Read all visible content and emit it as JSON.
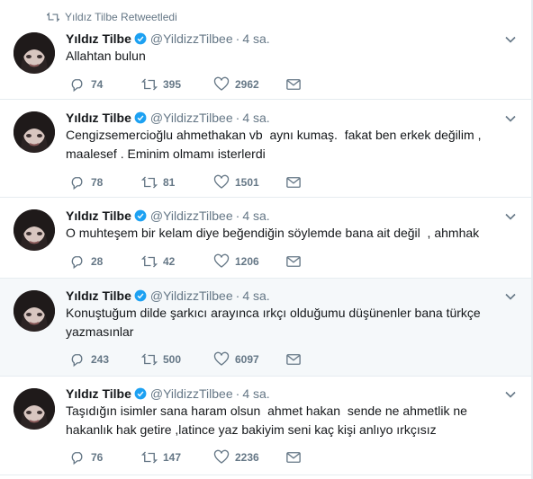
{
  "retweet_notice": "Yıldız Tilbe Retweetledi",
  "colors": {
    "verified": "#1da1f2",
    "muted": "#657786",
    "highlight_bg": "#f5f8fa"
  },
  "tweets": [
    {
      "name": "Yıldız Tilbe",
      "handle": "@YildizzTilbee",
      "time": "4 sa.",
      "text": "Allahtan bulun",
      "replies": "74",
      "retweets": "395",
      "likes": "2962"
    },
    {
      "name": "Yıldız Tilbe",
      "handle": "@YildizzTilbee",
      "time": "4 sa.",
      "text": "Cengizsemercioğlu ahmethakan vb  aynı kumaş.  fakat ben erkek değilim ,\nmaalesef . Eminim olmamı isterlerdi",
      "replies": "78",
      "retweets": "81",
      "likes": "1501"
    },
    {
      "name": "Yıldız Tilbe",
      "handle": "@YildizzTilbee",
      "time": "4 sa.",
      "text": "O muhteşem bir kelam diye beğendiğin söylemde bana ait değil  , ahmhak",
      "replies": "28",
      "retweets": "42",
      "likes": "1206"
    },
    {
      "name": "Yıldız Tilbe",
      "handle": "@YildizzTilbee",
      "time": "4 sa.",
      "text": "Konuştuğum dilde şarkıcı arayınca ırkçı olduğumu düşünenler bana türkçe\nyazmasınlar",
      "replies": "243",
      "retweets": "500",
      "likes": "6097"
    },
    {
      "name": "Yıldız Tilbe",
      "handle": "@YildizzTilbee",
      "time": "4 sa.",
      "text": "Taşıdığın isimler sana haram olsun  ahmet hakan  sende ne ahmetlik ne\nhakanlık hak getire ,latince yaz bakiyim seni kaç kişi anlıyo ırkçısız",
      "replies": "76",
      "retweets": "147",
      "likes": "2236"
    }
  ]
}
